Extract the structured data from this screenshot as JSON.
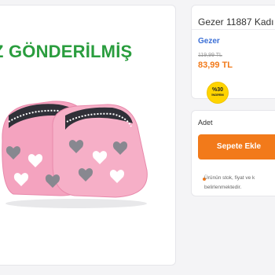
{
  "product": {
    "banner_text": "Z GÖNDERİLMİŞ",
    "title": "Gezer 11887 Kadı",
    "brand": "Gezer",
    "old_price": "119,99 TL",
    "new_price": "83,99 TL",
    "discount": {
      "percent": "%30",
      "label": "İNDİRİM"
    },
    "image_icon": "slipper-image"
  },
  "cart": {
    "quantity_label": "Adet",
    "add_button_label": "Sepete Ekle",
    "stock_note_line1": "Ürünün stok, fiyat ve k",
    "stock_note_line2": "belirlenmektedir."
  },
  "colors": {
    "accent": "#f27a1a",
    "brand_link": "#3b6fd6",
    "banner": "#2a9d3e",
    "badge": "#ffd400",
    "slipper_pink": "#f4a3bf"
  }
}
